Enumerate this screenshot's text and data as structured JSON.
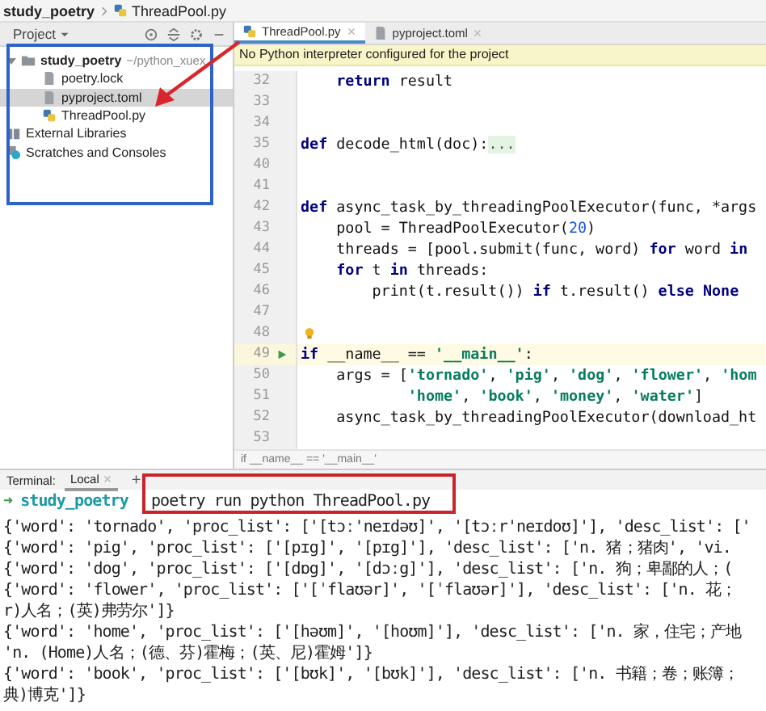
{
  "breadcrumb": {
    "project": "study_poetry",
    "file": "ThreadPool.py"
  },
  "project_panel": {
    "title": "Project",
    "tree": [
      {
        "name": "study_poetry",
        "path": "~/python_xuex",
        "kind": "folder",
        "expanded": true,
        "selected": false,
        "children": [
          {
            "name": "poetry.lock",
            "kind": "file",
            "selected": false
          },
          {
            "name": "pyproject.toml",
            "kind": "file",
            "selected": true
          },
          {
            "name": "ThreadPool.py",
            "kind": "python",
            "selected": false
          }
        ]
      },
      {
        "name": "External Libraries",
        "kind": "library",
        "selected": false
      },
      {
        "name": "Scratches and Consoles",
        "kind": "scratch",
        "selected": false
      }
    ]
  },
  "editor": {
    "tabs": [
      {
        "label": "ThreadPool.py",
        "kind": "python",
        "selected": true
      },
      {
        "label": "pyproject.toml",
        "kind": "file",
        "selected": false
      }
    ],
    "banner": "No Python interpreter configured for the project",
    "lines": [
      {
        "number": "32",
        "current": false,
        "tokens": [
          {
            "kind": "keyword",
            "text": "    return"
          },
          {
            "kind": "plain",
            "text": " result"
          }
        ]
      },
      {
        "number": "33",
        "current": false
      },
      {
        "number": "34",
        "current": false
      },
      {
        "number": "35",
        "current": false,
        "tokens": [
          {
            "kind": "keyword",
            "text": "def"
          },
          {
            "kind": "plain",
            "text": " decode_html(doc):"
          },
          {
            "kind": "folded",
            "text": "..."
          }
        ]
      },
      {
        "number": "40",
        "current": false
      },
      {
        "number": "41",
        "current": false
      },
      {
        "number": "42",
        "current": false,
        "tokens": [
          {
            "kind": "keyword",
            "text": "def"
          },
          {
            "kind": "plain",
            "text": " async_task_by_threadingPoolExecutor(func, *args"
          }
        ]
      },
      {
        "number": "43",
        "current": false,
        "tokens": [
          {
            "kind": "plain",
            "text": "    pool = ThreadPoolExecutor("
          },
          {
            "kind": "number",
            "text": "20"
          },
          {
            "kind": "plain",
            "text": ")"
          }
        ]
      },
      {
        "number": "44",
        "current": false,
        "tokens": [
          {
            "kind": "plain",
            "text": "    threads = [pool.submit(func, word) "
          },
          {
            "kind": "keyword",
            "text": "for"
          },
          {
            "kind": "plain",
            "text": " word "
          },
          {
            "kind": "keyword",
            "text": "in"
          }
        ]
      },
      {
        "number": "45",
        "current": false,
        "tokens": [
          {
            "kind": "keyword",
            "text": "    for"
          },
          {
            "kind": "plain",
            "text": " t "
          },
          {
            "kind": "keyword",
            "text": "in"
          },
          {
            "kind": "plain",
            "text": " threads:"
          }
        ]
      },
      {
        "number": "46",
        "current": false,
        "tokens": [
          {
            "kind": "plain",
            "text": "        print(t.result()) "
          },
          {
            "kind": "keyword",
            "text": "if"
          },
          {
            "kind": "plain",
            "text": " t.result() "
          },
          {
            "kind": "keyword",
            "text": "else"
          },
          {
            "kind": "keyword",
            "text": " None"
          }
        ]
      },
      {
        "number": "47",
        "current": false
      },
      {
        "number": "48",
        "current": false,
        "kind": "hint"
      },
      {
        "number": "49",
        "current": true,
        "kind": "run",
        "tokens": [
          {
            "kind": "keyword",
            "text": "if"
          },
          {
            "kind": "plain",
            "text": " __name__ == "
          },
          {
            "kind": "string",
            "text": "'__main__'"
          },
          {
            "kind": "plain",
            "text": ":"
          }
        ]
      },
      {
        "number": "50",
        "current": false,
        "tokens": [
          {
            "kind": "plain",
            "text": "    args = ["
          },
          {
            "kind": "string",
            "text": "'tornado'"
          },
          {
            "kind": "plain",
            "text": ", "
          },
          {
            "kind": "string",
            "text": "'pig'"
          },
          {
            "kind": "plain",
            "text": ", "
          },
          {
            "kind": "string",
            "text": "'dog'"
          },
          {
            "kind": "plain",
            "text": ", "
          },
          {
            "kind": "string",
            "text": "'flower'"
          },
          {
            "kind": "plain",
            "text": ", "
          },
          {
            "kind": "string",
            "text": "'hom"
          }
        ]
      },
      {
        "number": "51",
        "current": false,
        "tokens": [
          {
            "kind": "string",
            "text": "            'home'"
          },
          {
            "kind": "plain",
            "text": ", "
          },
          {
            "kind": "string",
            "text": "'book'"
          },
          {
            "kind": "plain",
            "text": ", "
          },
          {
            "kind": "string",
            "text": "'money'"
          },
          {
            "kind": "plain",
            "text": ", "
          },
          {
            "kind": "string",
            "text": "'water'"
          },
          {
            "kind": "plain",
            "text": "]"
          }
        ]
      },
      {
        "number": "52",
        "current": false,
        "tokens": [
          {
            "kind": "plain",
            "text": "    async_task_by_threadingPoolExecutor(download_ht"
          }
        ]
      },
      {
        "number": "53",
        "current": false
      }
    ],
    "footer": "if __name__ == '__main__'"
  },
  "terminal": {
    "label": "Terminal:",
    "tabs": [
      {
        "label": "Local",
        "selected": true
      }
    ],
    "add": "+",
    "prompt": {
      "arrow": "➜",
      "dir": "study_poetry",
      "command": "poetry run python ThreadPool.py"
    },
    "output": [
      "{'word': 'tornado', 'proc_list': ['[tɔː'neɪdəʊ]', '[tɔːr'neɪdoʊ]'], 'desc_list': ['",
      "{'word': 'pig', 'proc_list': ['[pɪg]', '[pɪg]'], 'desc_list': ['n. 猪；猪肉', 'vi.",
      "{'word': 'dog', 'proc_list': ['[dɒg]', '[dɔːg]'], 'desc_list': ['n. 狗；卑鄙的人；(",
      "{'word': 'flower', 'proc_list': ['[ˈflaʊər]', '[ˈflaʊər]'], 'desc_list': ['n. 花；",
      "r)人名；(英)弗劳尔']}",
      "{'word': 'home', 'proc_list': ['[həʊm]', '[hoʊm]'], 'desc_list': ['n. 家，住宅；产地",
      "'n. (Home)人名；(德、芬)霍梅；(英、尼)霍姆']}",
      "{'word': 'book', 'proc_list': ['[bʊk]', '[bʊk]'], 'desc_list': ['n. 书籍；卷；账簿；",
      "典)博克']}"
    ]
  }
}
